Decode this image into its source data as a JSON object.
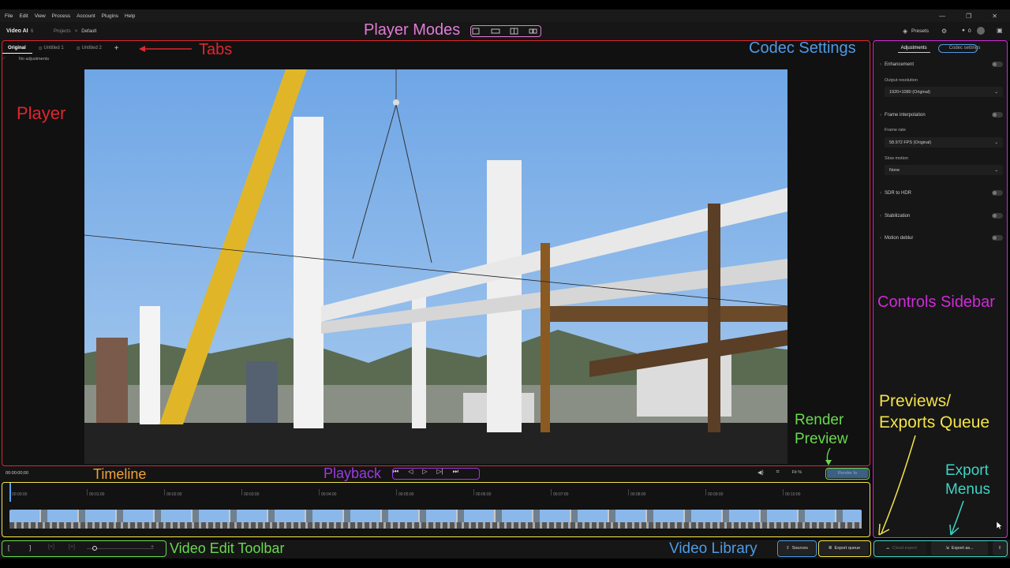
{
  "menu": [
    "File",
    "Edit",
    "View",
    "Process",
    "Account",
    "Plugins",
    "Help"
  ],
  "window_controls": [
    "—",
    "❐",
    "✕"
  ],
  "app": {
    "title": "Video AI",
    "version": "6",
    "breadcrumb_parent": "Projects",
    "breadcrumb_sep": ">",
    "breadcrumb_current": "Default"
  },
  "header": {
    "presets_label": "Presets",
    "credits": "0"
  },
  "tabs": [
    {
      "label": "Original"
    },
    {
      "label": "Untitled 1"
    },
    {
      "label": "Untitled 2"
    }
  ],
  "add_tab": "+",
  "subbar": {
    "label": "No adjustments"
  },
  "sidebar": {
    "tabs": [
      "Adjustments",
      "Codec settings"
    ],
    "enhancement": "Enhancement",
    "output_resolution_label": "Output resolution",
    "output_resolution_value": "1920×1080 (Original)",
    "frame_interpolation": "Frame interpolation",
    "frame_rate_label": "Frame rate",
    "frame_rate_value": "58.972 FPS (Original)",
    "slow_motion_label": "Slow motion",
    "slow_motion_value": "None",
    "sdr_to_hdr": "SDR to HDR",
    "stabilization": "Stabilization",
    "motion_deblur": "Motion deblur"
  },
  "playback": {
    "timecode": "00:00:00;00",
    "zoom": "Fit %",
    "render_label": "Render fa"
  },
  "timeline": {
    "ticks": [
      "00:00:00",
      "00:01:00",
      "00:02:00",
      "00:03:00",
      "00:04:00",
      "00:05:00",
      "00:06:00",
      "00:07:00",
      "00:08:00",
      "00:09:00",
      "00:10:00"
    ]
  },
  "bottom": {
    "sources_label": "Sources",
    "export_queue_label": "Export queue",
    "cloud_export_label": "Cloud export",
    "export_as_label": "Export as..."
  },
  "annotations": {
    "player_modes": "Player Modes",
    "tabs": "Tabs",
    "codec_settings": "Codec Settings",
    "player": "Player",
    "controls_sidebar": "Controls Sidebar",
    "previews_line1": "Previews/",
    "previews_line2": "Exports Queue",
    "render_line1": "Render",
    "render_line2": "Preview",
    "timeline": "Timeline",
    "playback": "Playback",
    "export_line1": "Export",
    "export_line2": "Menus",
    "video_edit_toolbar": "Video Edit Toolbar",
    "video_library": "Video Library"
  },
  "colors": {
    "red": "#e0262f",
    "pink": "#e27bd6",
    "blue": "#4d9be6",
    "magenta": "#d02ad8",
    "yellow": "#f2e34a",
    "orange": "#f0a23a",
    "purple": "#9b3ae0",
    "green": "#69d94f",
    "teal": "#3fd3c4"
  }
}
